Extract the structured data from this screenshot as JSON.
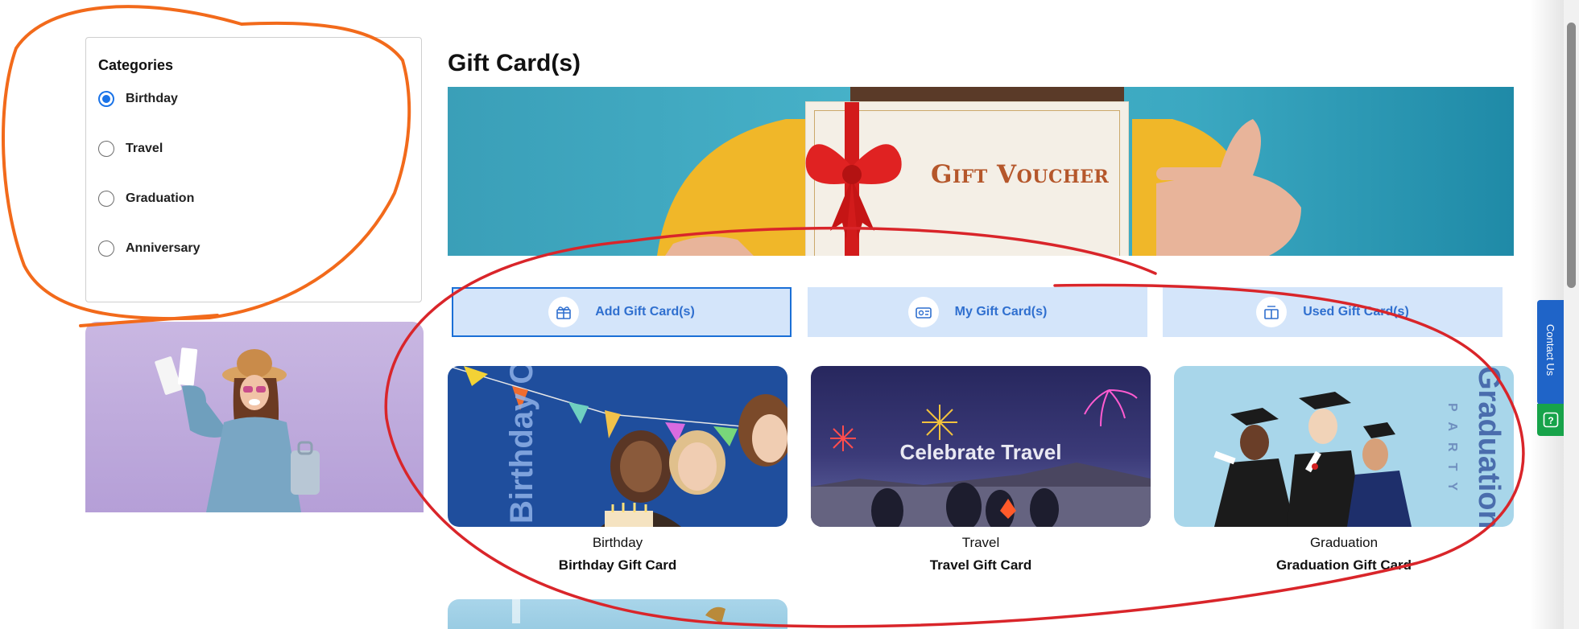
{
  "sidebar": {
    "title": "Categories",
    "items": [
      {
        "label": "Birthday",
        "checked": true
      },
      {
        "label": "Travel",
        "checked": false
      },
      {
        "label": "Graduation",
        "checked": false
      },
      {
        "label": "Anniversary",
        "checked": false
      }
    ]
  },
  "main": {
    "title": "Gift Card(s)",
    "banner_text": "Gift Voucher",
    "tabs": [
      {
        "label": "Add Gift Card(s)",
        "icon": "gift-card-add-icon"
      },
      {
        "label": "My Gift Card(s)",
        "icon": "gift-card-wallet-icon"
      },
      {
        "label": "Used Gift Card(s)",
        "icon": "gift-card-used-icon"
      }
    ],
    "cards": [
      {
        "category": "Birthday",
        "name": "Birthday Gift Card",
        "image_text": "Birthday Celebration"
      },
      {
        "category": "Travel",
        "name": "Travel Gift Card",
        "image_text": "Celebrate Travel"
      },
      {
        "category": "Graduation",
        "name": "Graduation Gift Card",
        "image_text": "Graduation.",
        "image_subtext": "PARTY"
      }
    ]
  },
  "widgets": {
    "contact_label": "Contact Us",
    "help_icon": "question-icon"
  },
  "colors": {
    "accent": "#1a73e8",
    "tab_bg": "#d4e5fa",
    "tab_text": "#2f6fcf",
    "contact_bg": "#1f64c8",
    "help_bg": "#17a34a",
    "annotation_orange": "#f26a1b",
    "annotation_red": "#d9252a"
  }
}
